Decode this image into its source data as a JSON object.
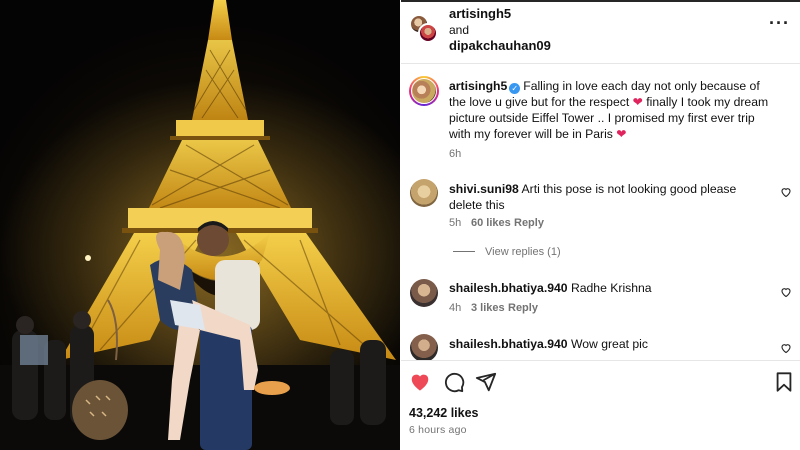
{
  "post": {
    "owner_primary": "artisingh5",
    "and_text": "and",
    "owner_secondary": "dipakchauhan09",
    "more_icon": "more-horizontal-icon"
  },
  "caption": {
    "username": "artisingh5",
    "text_part1": "Falling in love each day not only because of the love u give but for the respect",
    "text_part2": "finally I took my dream picture outside Eiffel Tower .. I promised my first ever trip with my forever will be in Paris",
    "heart": "❤",
    "time": "6h"
  },
  "comments": [
    {
      "username": "shivi.suni98",
      "text": "Arti this pose is not looking good please delete this",
      "time": "5h",
      "likes": "60 likes",
      "reply": "Reply",
      "view_replies": "View replies (1)"
    },
    {
      "username": "shailesh.bhatiya.940",
      "text": "Radhe Krishna",
      "time": "4h",
      "likes": "3 likes",
      "reply": "Reply"
    },
    {
      "username": "shailesh.bhatiya.940",
      "text": "Wow great pic"
    }
  ],
  "footer": {
    "likes": "43,242 likes",
    "time": "6 hours ago"
  },
  "colors": {
    "like_red": "#ed4956",
    "verified_blue": "#3897f0",
    "tower_gold": "#e5b21c"
  }
}
